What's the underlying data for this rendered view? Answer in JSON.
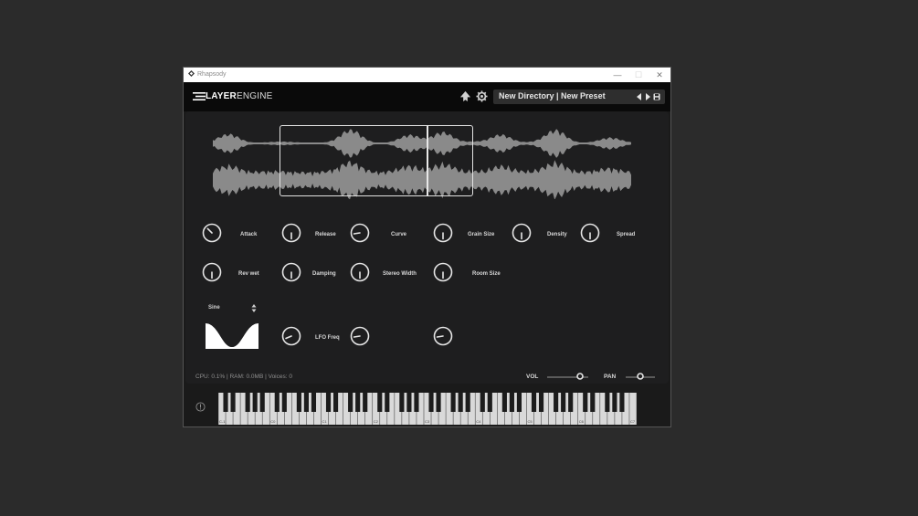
{
  "window": {
    "title": "Rhapsody",
    "controls": [
      "—",
      "☐",
      "✕"
    ]
  },
  "header": {
    "logo_bold": "LAYER",
    "logo_thin": "ENGINE",
    "preset_label": "New Directory | New Preset"
  },
  "knobs_row1": [
    {
      "label": "Attack",
      "value": 0.0
    },
    {
      "label": "Release",
      "value": 0.5
    },
    {
      "label": "Curve",
      "value": 0.2
    },
    {
      "label": "Grain Size",
      "value": 0.5
    },
    {
      "label": "Density",
      "value": 0.5
    },
    {
      "label": "Spread",
      "value": 0.5
    }
  ],
  "knobs_row2": [
    {
      "label": "Rev wet",
      "value": 0.5
    },
    {
      "label": "Damping",
      "value": 0.5
    },
    {
      "label": "Stereo Width",
      "value": 0.5
    },
    {
      "label": "Room Size",
      "value": 0.5
    }
  ],
  "lfo": {
    "shape": "Sine",
    "freq_label": "LFO Freq"
  },
  "status": {
    "text": "CPU: 0.1% | RAM: 0.0MB | Voices: 0"
  },
  "mix": {
    "vol_label": "VOL",
    "pan_label": "PAN",
    "vol_value": 0.8,
    "pan_value": 0.5
  },
  "keyboard": {
    "octave_labels": [
      "C-1",
      "C0",
      "C1",
      "C2",
      "C3",
      "C4",
      "C5",
      "C6",
      "C7"
    ]
  },
  "colors": {
    "background": "#2b2b2b",
    "panel": "#1e1e1f",
    "header": "#0a0a0a",
    "waveform": "#8a8a8a",
    "accent": "#e2e2e2"
  }
}
